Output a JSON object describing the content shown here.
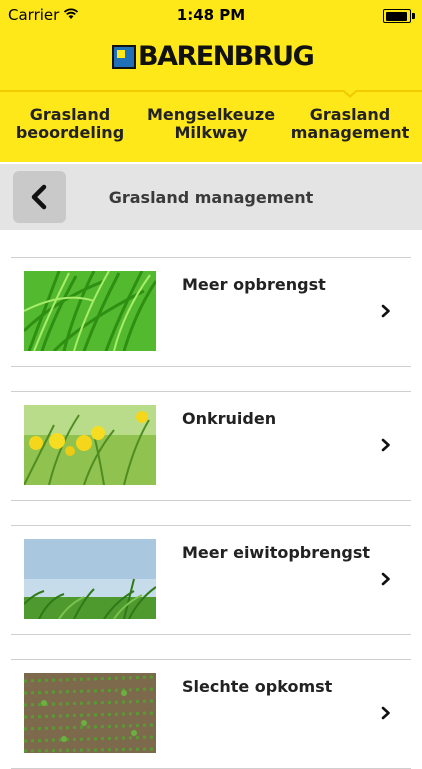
{
  "status_bar": {
    "carrier": "Carrier",
    "time": "1:48 PM",
    "battery_level": 1.0,
    "wifi_icon": "wifi-icon",
    "battery_icon": "battery-icon"
  },
  "brand": {
    "logo_text": "BARENBRUG",
    "accent_color": "#ffe81a",
    "logo_blue": "#1f70b6"
  },
  "tabs": [
    {
      "line1": "Grasland",
      "line2": "beoordeling",
      "selected": false
    },
    {
      "line1": "Mengselkeuze",
      "line2": "Milkway",
      "selected": false
    },
    {
      "line1": "Grasland",
      "line2": "management",
      "selected": true
    }
  ],
  "header": {
    "title": "Grasland management",
    "back_icon": "chevron-left-icon"
  },
  "items": [
    {
      "label": "Meer opbrengst",
      "image": "grass-photo"
    },
    {
      "label": "Onkruiden",
      "image": "dandelion-photo"
    },
    {
      "label": "Meer eiwitopbrengst",
      "image": "grass-sky-photo"
    },
    {
      "label": "Slechte opkomst",
      "image": "field-rows-photo"
    }
  ]
}
